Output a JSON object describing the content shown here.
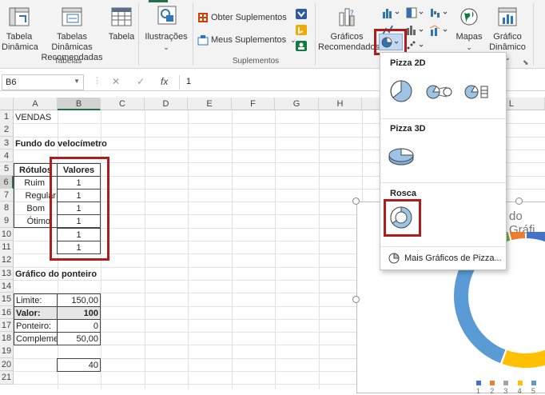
{
  "ribbon": {
    "tabela_dinamica": [
      "Tabela",
      "Dinâmica"
    ],
    "tabelas_dinamicas_recomendadas": [
      "Tabelas Dinâmicas",
      "Recomendadas"
    ],
    "tabela": "Tabela",
    "group_tabelas": "Tabelas",
    "ilustracoes": "Ilustrações",
    "obter_suplementos": "Obter Suplementos",
    "meus_suplementos": "Meus Suplementos",
    "group_suplementos": "Suplementos",
    "graficos_recomendados": [
      "Gráficos",
      "Recomendados"
    ],
    "mapas": "Mapas",
    "grafico_dinamico": [
      "Gráfico",
      "Dinâmico"
    ]
  },
  "formula_bar": {
    "name_box": "B6",
    "cancel_symbol": "✕",
    "enter_symbol": "✓",
    "fx_symbol": "fx",
    "value": "1"
  },
  "columns": [
    "A",
    "B",
    "C",
    "D",
    "E",
    "F",
    "G",
    "H",
    "I",
    "L"
  ],
  "rows": [
    "1",
    "2",
    "3",
    "4",
    "5",
    "6",
    "7",
    "8",
    "9",
    "10",
    "11",
    "12",
    "13",
    "14",
    "15",
    "16",
    "17",
    "18",
    "19",
    "20",
    "21"
  ],
  "cells": {
    "a1": "VENDAS",
    "a3": "Fundo do velocímetro",
    "a5": "Rótulos",
    "b5": "Valores",
    "a6": "Ruim",
    "a7": "Regular",
    "a8": "Bom",
    "a9": "Ótimo",
    "b6": "1",
    "b7": "1",
    "b8": "1",
    "b9": "1",
    "b10": "1",
    "b11": "1",
    "a13": "Gráfico do ponteiro",
    "a15": "Limite:",
    "b15": "150,00",
    "a16": "Valor:",
    "b16": "100",
    "a17": "Ponteiro:",
    "b17": "0",
    "a18": "Complemento",
    "b18": "50,00",
    "b20": "40"
  },
  "dropdown": {
    "section_2d": "Pizza 2D",
    "section_3d": "Pizza 3D",
    "section_rosca": "Rosca",
    "more": "Mais Gráficos de Pizza..."
  },
  "chart": {
    "title_fragment": "do Gráfi",
    "legend": [
      "1",
      "2",
      "3",
      "4",
      "5"
    ],
    "colors": [
      "#4472c4",
      "#ed7d31",
      "#a5a5a5",
      "#ffc000",
      "#5b9bd5",
      "#70ad47"
    ]
  }
}
